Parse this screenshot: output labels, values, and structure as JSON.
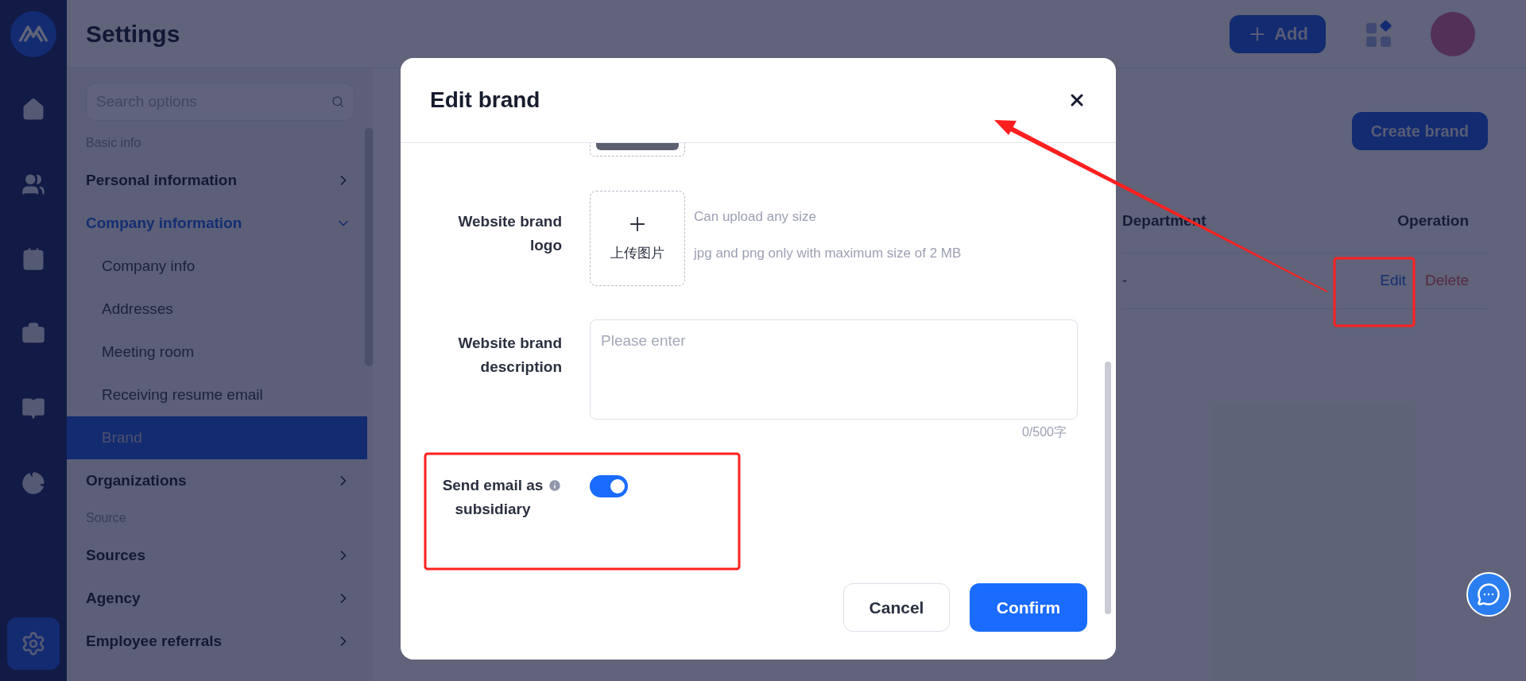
{
  "rail": [
    {
      "kind": "home",
      "selected": false
    },
    {
      "kind": "people",
      "selected": false
    },
    {
      "kind": "calendar",
      "selected": false
    },
    {
      "kind": "briefcase",
      "selected": false
    },
    {
      "kind": "book",
      "selected": false
    },
    {
      "kind": "chart",
      "selected": false
    },
    {
      "kind": "settings",
      "selected": true
    }
  ],
  "header": {
    "title": "Settings",
    "add_button": "Add"
  },
  "settings_nav": {
    "search_placeholder": "Search options",
    "sections": [
      {
        "heading": "Basic info",
        "items": [
          {
            "label": "Personal information",
            "expanded": false
          },
          {
            "label": "Company information",
            "expanded": true,
            "children": [
              {
                "label": "Company info",
                "selected": false
              },
              {
                "label": "Addresses",
                "selected": false
              },
              {
                "label": "Meeting room",
                "selected": false
              },
              {
                "label": "Receiving resume email",
                "selected": false
              },
              {
                "label": "Brand",
                "selected": true
              }
            ]
          },
          {
            "label": "Organizations",
            "expanded": false
          }
        ]
      },
      {
        "heading": "Source",
        "items": [
          {
            "label": "Sources",
            "expanded": false
          },
          {
            "label": "Agency",
            "expanded": false
          },
          {
            "label": "Employee referrals",
            "expanded": false
          }
        ]
      }
    ]
  },
  "content": {
    "create_button": "Create brand",
    "table": {
      "columns": [
        "Department",
        "Operation"
      ],
      "rows": [
        {
          "department": "-",
          "actions": [
            {
              "label": "Edit",
              "kind": "edit"
            },
            {
              "label": "Delete",
              "kind": "delete"
            }
          ]
        }
      ]
    }
  },
  "dialog": {
    "title": "Edit brand",
    "fields": [
      {
        "kind": "upload",
        "label": "Website brand logo",
        "button": "上传图片",
        "hints": [
          "Can upload any size",
          "jpg and png only with maximum size of 2 MB"
        ]
      },
      {
        "kind": "textarea",
        "label": "Website brand description",
        "placeholder": "Please enter",
        "counter": "0/500字"
      },
      {
        "kind": "switch",
        "label": "Send email as subsidiary",
        "info": true,
        "on": true
      }
    ],
    "buttons": [
      {
        "label": "Cancel",
        "primary": false
      },
      {
        "label": "Confirm",
        "primary": true
      }
    ]
  }
}
